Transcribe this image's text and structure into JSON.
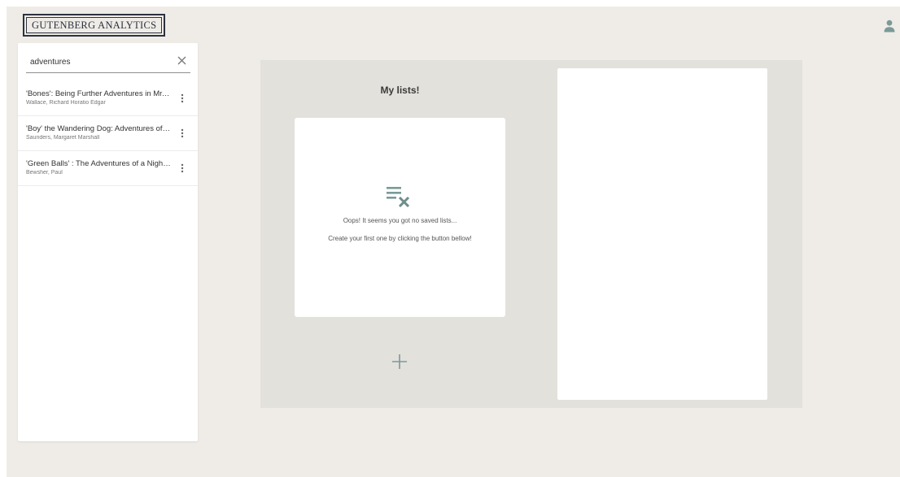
{
  "header": {
    "logo_text": "GUTENBERG ANALYTICS",
    "user_icon": "person-icon"
  },
  "search": {
    "value": "adventures",
    "placeholder": "",
    "clear_icon": "close-icon",
    "results": [
      {
        "title": "'Bones': Being Further Adventures in Mr. ...",
        "author": "Wallace, Richard Horatio Edgar"
      },
      {
        "title": "'Boy' the Wandering Dog: Adventures of ...",
        "author": "Saunders, Margaret Marshall"
      },
      {
        "title": "'Green Balls' : The Adventures of a Night-...",
        "author": "Bewsher, Paul"
      }
    ]
  },
  "lists": {
    "title": "My lists!",
    "empty_icon": "playlist-remove-icon",
    "empty_line1": "Oops! It seems you got no saved lists...",
    "empty_line2": "Create your first one by clicking the button bellow!",
    "add_icon": "plus-icon"
  },
  "colors": {
    "app_background": "#efece7",
    "section_background": "#e3e1dc",
    "accent_icon": "#7a9a98",
    "logo_ink": "#2c3240"
  }
}
